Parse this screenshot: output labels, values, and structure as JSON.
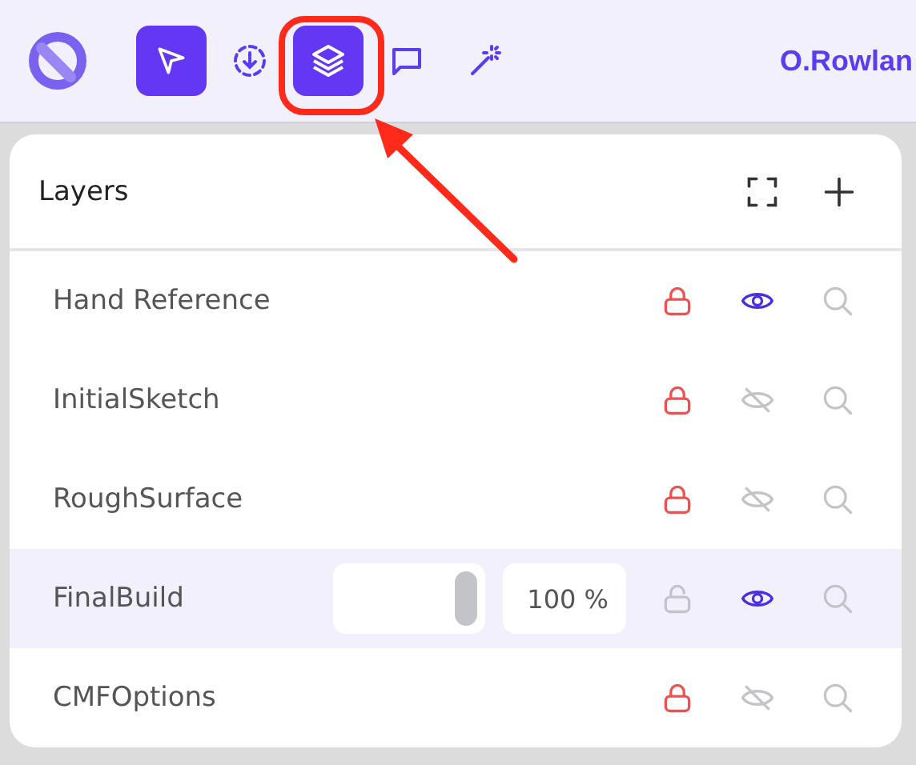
{
  "toolbar": {
    "tools": [
      {
        "kind": "select",
        "selected": true
      },
      {
        "kind": "capture",
        "selected": false
      },
      {
        "kind": "layers",
        "selected": true
      },
      {
        "kind": "comment",
        "selected": false
      },
      {
        "kind": "wand",
        "selected": false
      }
    ],
    "user": "O.Rowlan"
  },
  "panel": {
    "title": "Layers",
    "layers": [
      {
        "name": "Hand Reference",
        "locked": true,
        "visible": true,
        "selected": false
      },
      {
        "name": "InitialSketch",
        "locked": true,
        "visible": false,
        "selected": false
      },
      {
        "name": "RoughSurface",
        "locked": true,
        "visible": false,
        "selected": false
      },
      {
        "name": "FinalBuild",
        "locked": false,
        "visible": true,
        "selected": true,
        "opacity": {
          "level": 1,
          "reading": "100 %"
        }
      },
      {
        "name": "CMFOptions",
        "locked": true,
        "visible": false,
        "selected": false
      }
    ]
  }
}
